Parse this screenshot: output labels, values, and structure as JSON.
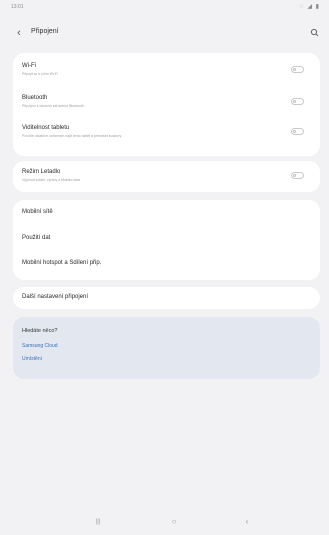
{
  "status": {
    "time": "13:01",
    "icons": "◌ ◢ ▮"
  },
  "header": {
    "back_glyph": "‹",
    "title": "Připojení"
  },
  "card1": {
    "rows": [
      {
        "title": "Wi-Fi",
        "subtitle": "Připojit se k sítím Wi-Fi"
      },
      {
        "title": "Bluetooth",
        "subtitle": "Připojení k okolním zařízením Bluetooth"
      },
      {
        "title": "Viditelnost tabletu",
        "subtitle": "Povolte ostatním zařízením najít tento tablet a přenášet soubory"
      }
    ]
  },
  "card2": {
    "title": "Režim Letadlo",
    "subtitle": "Vypnout volání, zprávy a Mobilní data"
  },
  "card3": {
    "items": [
      "Mobilní sítě",
      "Použití dat",
      "Mobilní hotspot a Sdílení přip."
    ]
  },
  "card4": {
    "label": "Další nastavení připojení"
  },
  "help": {
    "title": "Hledáte něco?",
    "links": [
      "Samsung Cloud",
      "Umístění"
    ]
  },
  "nav": {
    "recent": "|||",
    "home": "○",
    "back": "‹"
  }
}
